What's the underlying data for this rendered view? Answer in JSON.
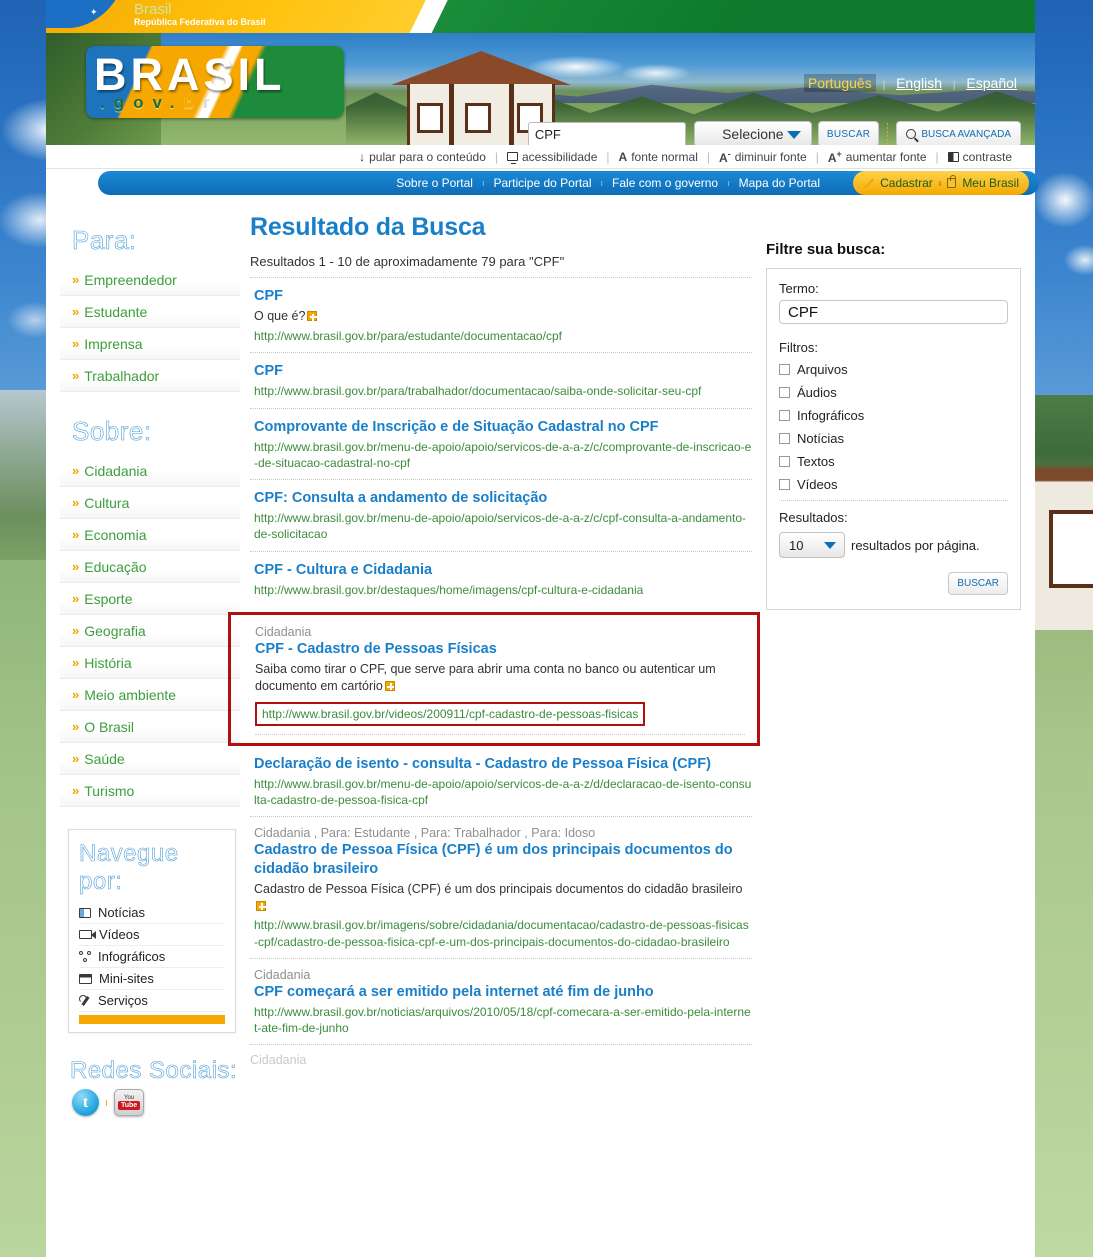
{
  "gov_band": {
    "title": "Brasil",
    "subtitle": "República Federativa do Brasil"
  },
  "logo": {
    "top": "BRASIL",
    "dot1": ".",
    "g": "g",
    "o": "o",
    "v": "v",
    "dot2": ".",
    "b": "b",
    "r": "r",
    "bottom_plain": ". g o v . b r"
  },
  "languages": {
    "items": [
      "Português",
      "English",
      "Español"
    ],
    "active": "Português",
    "separator": "|"
  },
  "search": {
    "value": "CPF",
    "placeholder": "",
    "select_label": "Selecione",
    "buscar_label": "BUSCAR",
    "advanced_label": "BUSCA AVANÇADA"
  },
  "accessibility": {
    "items": [
      {
        "label": "pular para o conteúdo",
        "icon": "down-arrow-icon"
      },
      {
        "label": "acessibilidade",
        "icon": "screen-icon"
      },
      {
        "label": "fonte normal",
        "icon": "letter-a-icon"
      },
      {
        "label": "diminuir fonte",
        "icon": "letter-a-minus-icon"
      },
      {
        "label": "aumentar fonte",
        "icon": "letter-a-plus-icon"
      },
      {
        "label": "contraste",
        "icon": "contrast-icon"
      }
    ],
    "separator": "|"
  },
  "navbar": {
    "items": [
      "Sobre o Portal",
      "Participe do Portal",
      "Fale com o governo",
      "Mapa do Portal"
    ],
    "separator": "ı",
    "user": {
      "cadastrar": "Cadastrar",
      "meu_brasil": "Meu Brasil",
      "separator": "ı"
    }
  },
  "sidebar": {
    "group1_title": "Para:",
    "group1_items": [
      "Empreendedor",
      "Estudante",
      "Imprensa",
      "Trabalhador"
    ],
    "group2_title": "Sobre:",
    "group2_items": [
      "Cidadania",
      "Cultura",
      "Economia",
      "Educação",
      "Esporte",
      "Geografia",
      "História",
      "Meio ambiente",
      "O Brasil",
      "Saúde",
      "Turismo"
    ],
    "navigate_box": {
      "title": "Navegue por:",
      "items": [
        {
          "label": "Notícias",
          "icon": "news-icon"
        },
        {
          "label": "Vídeos",
          "icon": "video-camera-icon"
        },
        {
          "label": "Infográficos",
          "icon": "infographic-icon"
        },
        {
          "label": "Mini-sites",
          "icon": "window-icon"
        },
        {
          "label": "Serviços",
          "icon": "wrench-icon"
        }
      ]
    },
    "social": {
      "title": "Redes Sociais:",
      "twitter": "t",
      "youtube_top": "You",
      "youtube_bottom": "Tube",
      "separator": "ı"
    }
  },
  "main": {
    "page_title": "Resultado da Busca",
    "result_count": "Resultados 1 - 10 de aproximadamente 79 para \"CPF\"",
    "results": [
      {
        "category": "",
        "title": "CPF",
        "description": "O que é?",
        "has_plus": true,
        "url": "http://www.brasil.gov.br/para/estudante/documentacao/cpf",
        "highlighted": false
      },
      {
        "category": "",
        "title": "CPF",
        "description": "",
        "has_plus": false,
        "url": "http://www.brasil.gov.br/para/trabalhador/documentacao/saiba-onde-solicitar-seu-cpf",
        "highlighted": false
      },
      {
        "category": "",
        "title": "Comprovante de Inscrição e de Situação Cadastral no CPF",
        "description": "",
        "has_plus": false,
        "url": "http://www.brasil.gov.br/menu-de-apoio/apoio/servicos-de-a-a-z/c/comprovante-de-inscricao-e-de-situacao-cadastral-no-cpf",
        "highlighted": false
      },
      {
        "category": "",
        "title": "CPF: Consulta a andamento de solicitação",
        "description": "",
        "has_plus": false,
        "url": "http://www.brasil.gov.br/menu-de-apoio/apoio/servicos-de-a-a-z/c/cpf-consulta-a-andamento-de-solicitacao",
        "highlighted": false
      },
      {
        "category": "",
        "title": "CPF - Cultura e Cidadania",
        "description": "",
        "has_plus": false,
        "url": "http://www.brasil.gov.br/destaques/home/imagens/cpf-cultura-e-cidadania",
        "highlighted": false
      },
      {
        "category": "Cidadania",
        "title": "CPF - Cadastro de Pessoas Físicas",
        "description": "Saiba como tirar o CPF, que serve para abrir uma conta no banco ou autenticar um documento em cartório",
        "has_plus": true,
        "url": "http://www.brasil.gov.br/videos/200911/cpf-cadastro-de-pessoas-fisicas",
        "highlighted": true
      },
      {
        "category": "",
        "title": "Declaração de isento - consulta - Cadastro de Pessoa Física (CPF)",
        "description": "",
        "has_plus": false,
        "url": "http://www.brasil.gov.br/menu-de-apoio/apoio/servicos-de-a-a-z/d/declaracao-de-isento-consulta-cadastro-de-pessoa-fisica-cpf",
        "highlighted": false
      },
      {
        "category": "Cidadania , Para: Estudante , Para: Trabalhador , Para: Idoso",
        "title": "Cadastro de Pessoa Física (CPF) é um dos principais documentos do cidadão brasileiro",
        "description": "Cadastro de Pessoa Física (CPF) é um dos principais documentos do cidadão brasileiro",
        "has_plus": true,
        "url": "http://www.brasil.gov.br/imagens/sobre/cidadania/documentacao/cadastro-de-pessoas-fisicas-cpf/cadastro-de-pessoa-fisica-cpf-e-um-dos-principais-documentos-do-cidadao-brasileiro",
        "highlighted": false
      },
      {
        "category": "Cidadania",
        "title": "CPF começará a ser emitido pela internet até fim de junho",
        "description": "",
        "has_plus": false,
        "url": "http://www.brasil.gov.br/noticias/arquivos/2010/05/18/cpf-comecara-a-ser-emitido-pela-internet-ate-fim-de-junho",
        "highlighted": false
      }
    ],
    "tail_category": "Cidadania"
  },
  "rail": {
    "heading": "Filtre sua busca:",
    "term_label": "Termo:",
    "term_value": "CPF",
    "filters_label": "Filtros:",
    "filters": [
      {
        "label": "Arquivos",
        "checked": false
      },
      {
        "label": "Áudios",
        "checked": false
      },
      {
        "label": "Infográficos",
        "checked": false
      },
      {
        "label": "Notícias",
        "checked": false
      },
      {
        "label": "Textos",
        "checked": false
      },
      {
        "label": "Vídeos",
        "checked": false
      }
    ],
    "results_label": "Resultados:",
    "results_per_page": "10",
    "results_suffix": "resultados por página.",
    "buscar_label": "BUSCAR"
  },
  "colors": {
    "link_blue": "#1a7fc9",
    "url_green": "#3c8c3c",
    "accent_orange": "#f5a800",
    "highlight_red": "#b01010",
    "nav_blue": "#0e6cb6"
  }
}
